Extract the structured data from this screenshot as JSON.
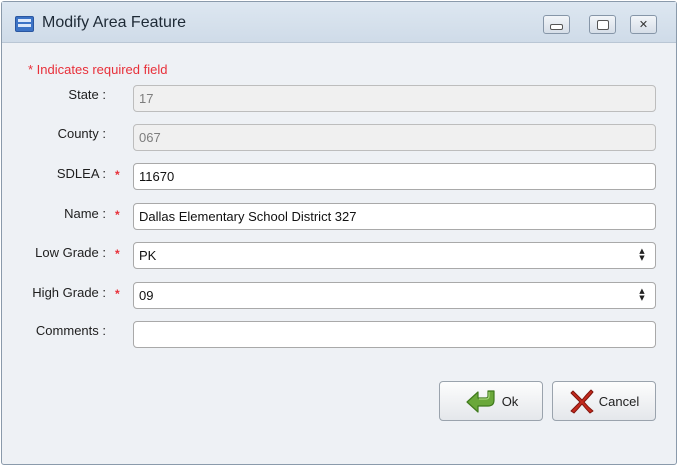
{
  "window": {
    "title": "Modify Area Feature",
    "app_icon": "app-logo-icon",
    "controls": [
      "minimize-icon",
      "maximize-icon",
      "close-icon"
    ]
  },
  "form": {
    "required_note": "* Indicates required field",
    "fields": {
      "state": {
        "label": "State :",
        "value": "17",
        "required": false,
        "disabled": true
      },
      "county": {
        "label": "County :",
        "value": "067",
        "required": false,
        "disabled": true
      },
      "sdlea": {
        "label": "SDLEA :",
        "value": "11670",
        "required": true
      },
      "name": {
        "label": "Name :",
        "value": "Dallas Elementary School District 327",
        "required": true
      },
      "low_grade": {
        "label": "Low Grade :",
        "value": "PK",
        "required": true
      },
      "high_grade": {
        "label": "High Grade :",
        "value": "09",
        "required": true
      },
      "comments": {
        "label": "Comments :",
        "value": "",
        "required": false
      }
    },
    "required_marker": "*"
  },
  "buttons": {
    "ok": {
      "label": "Ok",
      "icon": "green-arrow-icon"
    },
    "cancel": {
      "label": "Cancel",
      "icon": "red-x-icon"
    }
  },
  "colors": {
    "required_red": "#e8303a",
    "titlebar": "#d6e1ed",
    "window_bg": "#eef1f5"
  }
}
